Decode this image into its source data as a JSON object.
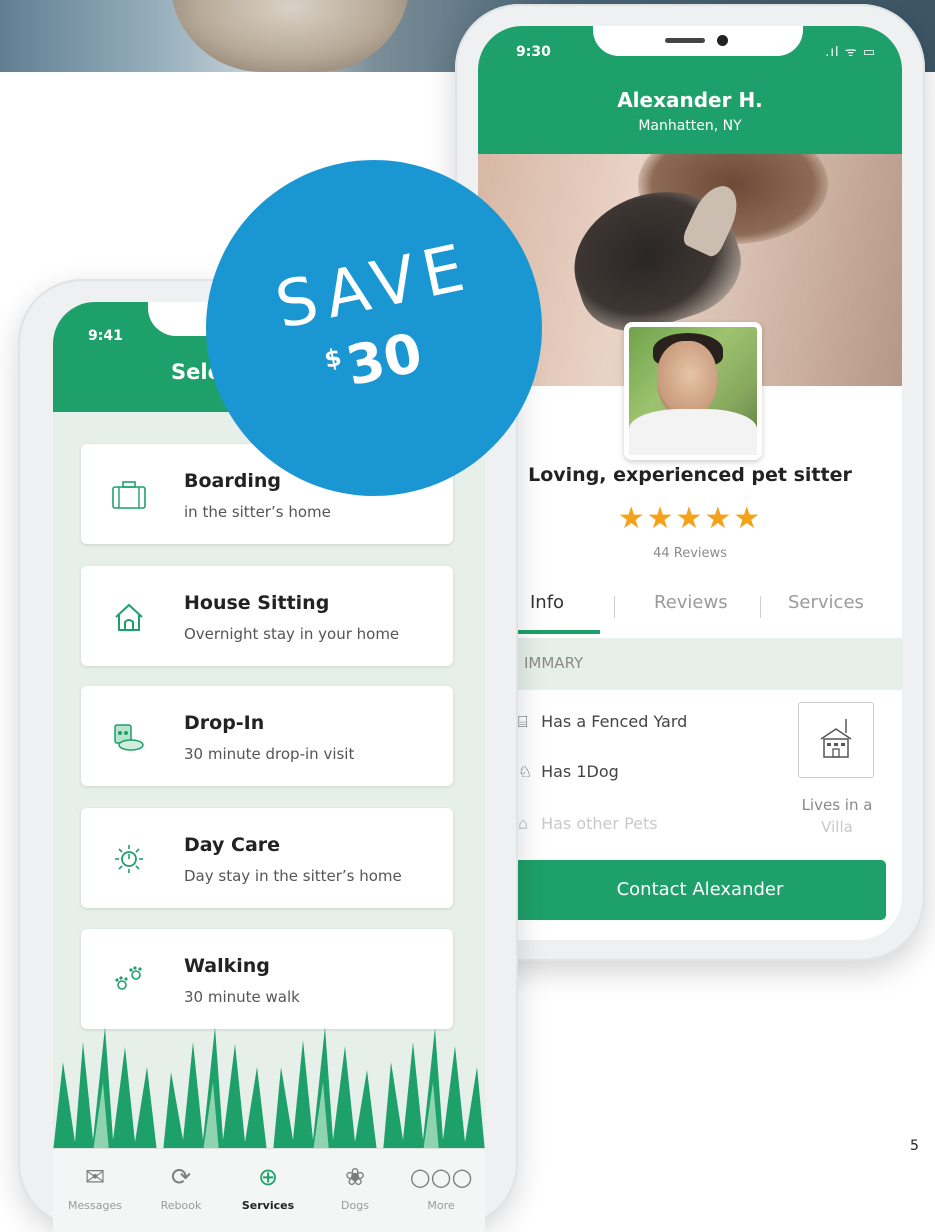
{
  "right_phone": {
    "time": "9:30",
    "status_icons": ".ıl ᯤ ▭",
    "name": "Alexander H.",
    "location": "Manhatten, NY",
    "tagline": "Loving, experienced pet sitter",
    "stars": "★★★★★",
    "rating": 5,
    "reviews_count": "44 Reviews",
    "tabs": [
      {
        "label": "Info",
        "active": true
      },
      {
        "label": "Reviews",
        "active": false
      },
      {
        "label": "Services",
        "active": false
      }
    ],
    "summary_label": "IMMARY",
    "features": [
      {
        "label": "Has a Fenced Yard",
        "icon": "fence-icon"
      },
      {
        "label": "Has 1Dog",
        "icon": "dog-icon"
      },
      {
        "label": "Has other Pets",
        "icon": "pets-icon"
      }
    ],
    "home_type": {
      "line1": "Lives in a",
      "line2": "Villa",
      "icon": "house-icon"
    },
    "contact_button": "Contact Alexander"
  },
  "left_phone": {
    "time": "9:41",
    "title": "Sele",
    "services": [
      {
        "title": "Boarding",
        "subtitle": "in the sitter’s home",
        "icon": "suitcase-icon"
      },
      {
        "title": "House Sitting",
        "subtitle": "Overnight stay in your home",
        "icon": "house-icon"
      },
      {
        "title": "Drop-In",
        "subtitle": "30 minute drop-in visit",
        "icon": "food-can-icon"
      },
      {
        "title": "Day Care",
        "subtitle": "Day stay in the sitter’s home",
        "icon": "sun-icon"
      },
      {
        "title": "Walking",
        "subtitle": "30 minute walk",
        "icon": "paw-prints-icon"
      }
    ],
    "tabbar": [
      {
        "label": "Messages",
        "icon": "envelope-icon",
        "active": false
      },
      {
        "label": "Rebook",
        "icon": "refresh-icon",
        "active": false
      },
      {
        "label": "Services",
        "icon": "plus-circle-icon",
        "active": true
      },
      {
        "label": "Dogs",
        "icon": "paw-icon",
        "active": false
      },
      {
        "label": "More",
        "icon": "ellipsis-icon",
        "active": false
      }
    ]
  },
  "badge": {
    "save": "SAVE",
    "currency": "$",
    "amount": "30"
  },
  "page_number": "5",
  "colors": {
    "brand_green": "#1ea06a",
    "badge_blue": "#1a97d2",
    "star_orange": "#f5a21b"
  }
}
